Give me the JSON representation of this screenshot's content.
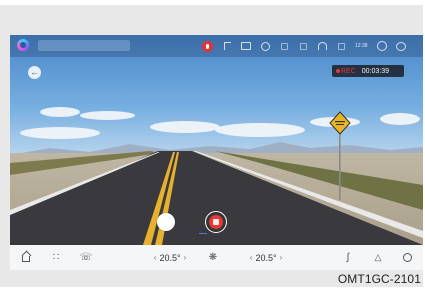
{
  "status_bar": {
    "time_text": "12:38",
    "icons": [
      "app-logo-icon",
      "mic-icon",
      "flag-icon",
      "camera-icon",
      "gear-icon",
      "signal-icon",
      "bluetooth-icon",
      "wifi-icon",
      "profile-icon",
      "brand-icon"
    ]
  },
  "recording": {
    "rec_label": "REC",
    "elapsed": "00:03:39"
  },
  "controls": {
    "back_icon": "back-arrow-icon",
    "capture_icon": "capture-button",
    "record_icon": "stop-record-button"
  },
  "bottom_bar": {
    "left_temp": "20.5°",
    "right_temp": "20.5°",
    "icons": [
      "home-icon",
      "apps-icon",
      "phone-icon",
      "fan-icon",
      "seat-heat-icon",
      "navigation-icon",
      "music-icon"
    ]
  },
  "caption": "OMT1GC-2101",
  "colors": {
    "rec_red": "#e53935",
    "sky_top": "#4a86c8",
    "bottom_bar_bg": "#f4f6f8",
    "road": "#3a3a3e",
    "center_line": "#e6b12d"
  }
}
